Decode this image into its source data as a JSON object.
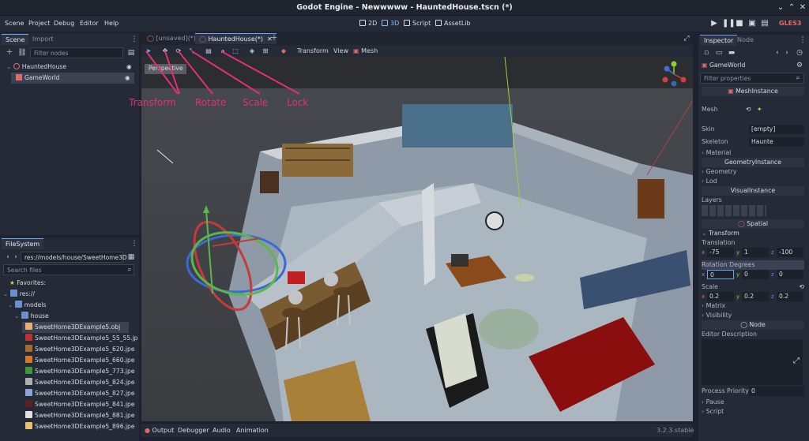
{
  "window": {
    "title": "Godot Engine - Newwwww - HauntedHouse.tscn (*)"
  },
  "menu": [
    "Scene",
    "Project",
    "Debug",
    "Editor",
    "Help"
  ],
  "modes": {
    "d2": "2D",
    "d3": "3D",
    "script": "Script",
    "assetlib": "AssetLib"
  },
  "renderer": "GLES3",
  "scene_dock": {
    "tabs": [
      "Scene",
      "Import"
    ],
    "filter_placeholder": "Filter nodes",
    "nodes": [
      "HauntedHouse",
      "GameWorld"
    ]
  },
  "filesystem": {
    "tab": "FileSystem",
    "path": "res://models/house/SweetHome3D",
    "search_placeholder": "Search files",
    "favorites": "Favorites:",
    "tree": [
      "res://",
      "models",
      "house"
    ],
    "files": [
      "SweetHome3DExample5.obj",
      "SweetHome3DExample5_55_55.jp",
      "SweetHome3DExample5_620.jpe",
      "SweetHome3DExample5_660.jpe",
      "SweetHome3DExample5_773.jpe",
      "SweetHome3DExample5_824.jpe",
      "SweetHome3DExample5_827.jpe",
      "SweetHome3DExample5_841.jpe",
      "SweetHome3DExample5_881.jpe",
      "SweetHome3DExample5_896.jpe"
    ]
  },
  "editor_tabs": [
    "[unsaved](*)",
    "HauntedHouse(*)"
  ],
  "viewport_menu": {
    "transform": "Transform",
    "view": "View",
    "mesh": "Mesh"
  },
  "viewport": {
    "label": "Perspective"
  },
  "annotations": {
    "transform": "Transform",
    "rotate": "Rotate",
    "scale": "Scale",
    "lock": "Lock"
  },
  "bottom_tabs": [
    "Output",
    "Debugger",
    "Audio",
    "Animation"
  ],
  "version": "3.2.3.stable",
  "inspector": {
    "tabs": [
      "Inspector",
      "Node"
    ],
    "object": "GameWorld",
    "filter_placeholder": "Filter properties",
    "class_mesh": "MeshInstance",
    "mesh_label": "Mesh",
    "skin_label": "Skin",
    "skin_value": "[empty]",
    "skeleton_label": "Skeleton",
    "skeleton_value": "Haunte",
    "material": "Material",
    "geometry_instance": "GeometryInstance",
    "geometry": "Geometry",
    "lod": "Lod",
    "visual_instance": "VisualInstance",
    "layers": "Layers",
    "spatial": "Spatial",
    "transform": "Transform",
    "translation": "Translation",
    "translation_values": {
      "x": "-75",
      "y": "1",
      "z": "-100"
    },
    "rotation": "Rotation Degrees",
    "rotation_values": {
      "x": "0",
      "y": "0",
      "z": "0"
    },
    "scale": "Scale",
    "scale_values": {
      "x": "0.2",
      "y": "0.2",
      "z": "0.2"
    },
    "matrix": "Matrix",
    "visibility": "Visibility",
    "node": "Node",
    "editor_description": "Editor Description",
    "process_priority": "Process Priority",
    "process_priority_value": "0",
    "pause": "Pause",
    "script": "Script"
  },
  "colors": {
    "accent": "#6ea2f5",
    "annotation": "#e03078"
  }
}
